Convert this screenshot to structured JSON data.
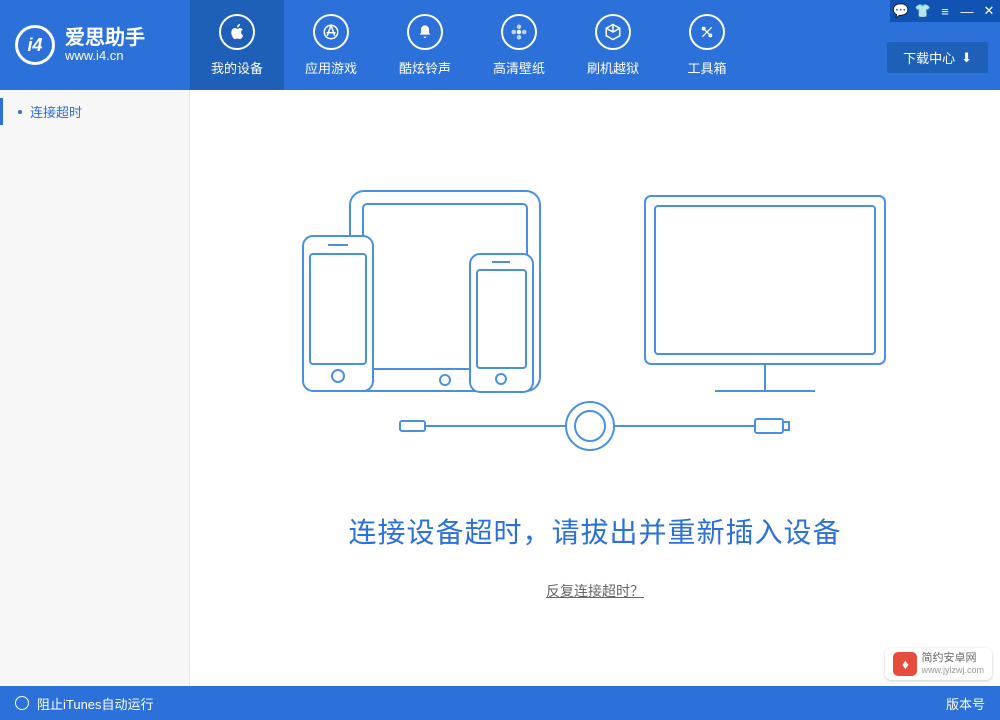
{
  "logo": {
    "badge": "i4",
    "title": "爱思助手",
    "url": "www.i4.cn"
  },
  "nav": [
    {
      "label": "我的设备",
      "icon": "apple"
    },
    {
      "label": "应用游戏",
      "icon": "apps"
    },
    {
      "label": "酷炫铃声",
      "icon": "bell"
    },
    {
      "label": "高清壁纸",
      "icon": "flower"
    },
    {
      "label": "刷机越狱",
      "icon": "box"
    },
    {
      "label": "工具箱",
      "icon": "tools"
    }
  ],
  "download_center": "下载中心",
  "sidebar": {
    "items": [
      {
        "label": "连接超时"
      }
    ]
  },
  "main": {
    "message": "连接设备超时，请拔出并重新插入设备",
    "link": "反复连接超时？"
  },
  "footer": {
    "itunes_block": "阻止iTunes自动运行",
    "version_label": "版本号"
  },
  "watermark": {
    "name": "简约安卓网",
    "url": "www.jylzwj.com"
  },
  "colors": {
    "primary": "#2b71d9",
    "primary_dark": "#1e5fb8"
  }
}
